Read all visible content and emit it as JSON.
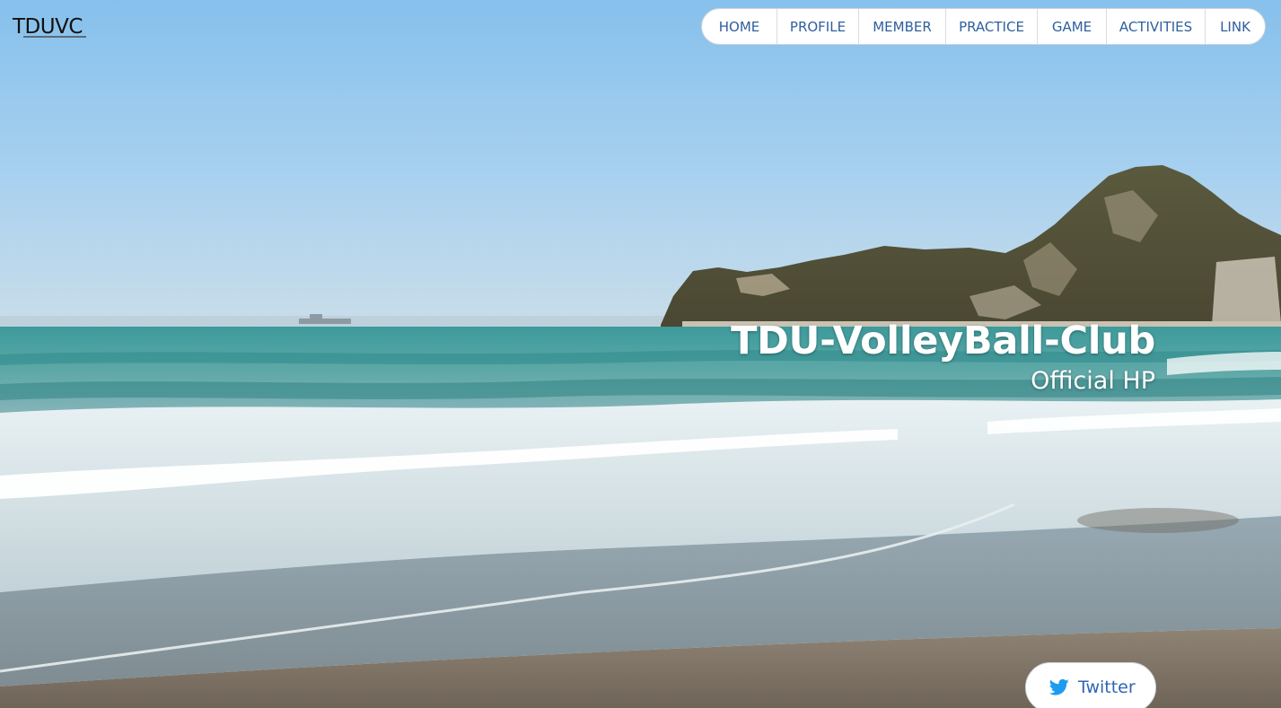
{
  "logo": {
    "text": "TDUVC"
  },
  "nav": {
    "items": [
      {
        "label": "HOME"
      },
      {
        "label": "PROFILE"
      },
      {
        "label": "MEMBER"
      },
      {
        "label": "PRACTICE"
      },
      {
        "label": "GAME"
      },
      {
        "label": "ACTIVITIES"
      },
      {
        "label": "LINK"
      }
    ]
  },
  "hero": {
    "title": "TDU-VolleyBall-Club",
    "subtitle": "Official HP"
  },
  "social": {
    "twitter_label": "Twitter",
    "icon": "twitter-bird-icon"
  },
  "colors": {
    "nav_text": "#2f5f9e",
    "twitter_text": "#2f66b3",
    "twitter_icon": "#1d9bf0"
  }
}
